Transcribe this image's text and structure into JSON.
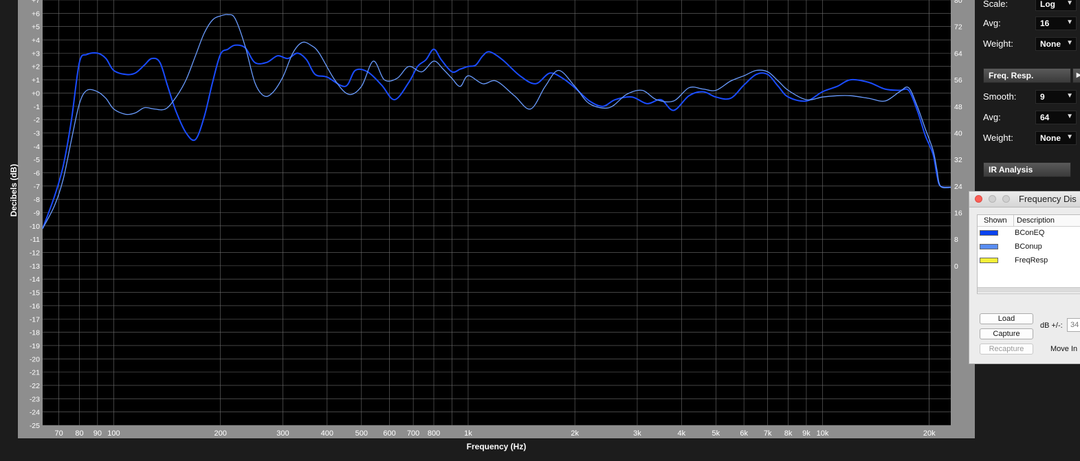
{
  "graph": {
    "y_axis_title": "Decibels (dB)",
    "x_axis_title": "Frequency (Hz)"
  },
  "chart_data": {
    "type": "line",
    "xscale": "log",
    "xlim": [
      63,
      23000
    ],
    "ylim": [
      -25,
      7
    ],
    "right_ylim": [
      -48,
      80
    ],
    "left_ticks": [
      "+7",
      "+6",
      "+5",
      "+4",
      "+3",
      "+2",
      "+1",
      "+0",
      "-1",
      "-2",
      "-3",
      "-4",
      "-5",
      "-6",
      "-7",
      "-8",
      "-9",
      "-10",
      "-11",
      "-12",
      "-13",
      "-14",
      "-15",
      "-16",
      "-17",
      "-18",
      "-19",
      "-20",
      "-21",
      "-22",
      "-23",
      "-24",
      "-25"
    ],
    "right_ticks": [
      "80",
      "72",
      "64",
      "56",
      "48",
      "40",
      "32",
      "24",
      "16",
      "8",
      "0"
    ],
    "x_ticks": [
      {
        "f": 70,
        "label": "70"
      },
      {
        "f": 80,
        "label": "80"
      },
      {
        "f": 90,
        "label": "90"
      },
      {
        "f": 100,
        "label": "100"
      },
      {
        "f": 200,
        "label": "200"
      },
      {
        "f": 300,
        "label": "300"
      },
      {
        "f": 400,
        "label": "400"
      },
      {
        "f": 500,
        "label": "500"
      },
      {
        "f": 600,
        "label": "600"
      },
      {
        "f": 700,
        "label": "700"
      },
      {
        "f": 800,
        "label": "800"
      },
      {
        "f": 1000,
        "label": "1k"
      },
      {
        "f": 2000,
        "label": "2k"
      },
      {
        "f": 3000,
        "label": "3k"
      },
      {
        "f": 4000,
        "label": "4k"
      },
      {
        "f": 5000,
        "label": "5k"
      },
      {
        "f": 6000,
        "label": "6k"
      },
      {
        "f": 7000,
        "label": "7k"
      },
      {
        "f": 8000,
        "label": "8k"
      },
      {
        "f": 9000,
        "label": "9k"
      },
      {
        "f": 10000,
        "label": "10k"
      },
      {
        "f": 20000,
        "label": "20k"
      }
    ],
    "series": [
      {
        "name": "BConEQ",
        "color": "#1a4cff",
        "points": [
          [
            63,
            -10.2
          ],
          [
            68,
            -7.8
          ],
          [
            72,
            -5.5
          ],
          [
            76,
            -2.0
          ],
          [
            80,
            2.3
          ],
          [
            84,
            2.9
          ],
          [
            90,
            3.0
          ],
          [
            95,
            2.6
          ],
          [
            100,
            1.7
          ],
          [
            108,
            1.4
          ],
          [
            115,
            1.5
          ],
          [
            122,
            2.1
          ],
          [
            128,
            2.6
          ],
          [
            135,
            2.3
          ],
          [
            142,
            0.5
          ],
          [
            150,
            -1.4
          ],
          [
            160,
            -3.0
          ],
          [
            170,
            -3.5
          ],
          [
            180,
            -1.8
          ],
          [
            190,
            0.8
          ],
          [
            200,
            2.9
          ],
          [
            210,
            3.3
          ],
          [
            220,
            3.6
          ],
          [
            235,
            3.4
          ],
          [
            250,
            2.3
          ],
          [
            270,
            2.3
          ],
          [
            290,
            2.8
          ],
          [
            310,
            2.6
          ],
          [
            330,
            3.0
          ],
          [
            350,
            2.5
          ],
          [
            370,
            1.4
          ],
          [
            400,
            1.2
          ],
          [
            450,
            0.5
          ],
          [
            480,
            1.7
          ],
          [
            520,
            1.6
          ],
          [
            570,
            0.6
          ],
          [
            620,
            -0.5
          ],
          [
            680,
            0.8
          ],
          [
            720,
            2.0
          ],
          [
            760,
            2.5
          ],
          [
            800,
            3.3
          ],
          [
            840,
            2.5
          ],
          [
            900,
            1.6
          ],
          [
            950,
            1.8
          ],
          [
            1000,
            2.0
          ],
          [
            1050,
            2.1
          ],
          [
            1100,
            2.8
          ],
          [
            1150,
            3.1
          ],
          [
            1250,
            2.5
          ],
          [
            1400,
            1.3
          ],
          [
            1550,
            0.7
          ],
          [
            1700,
            1.5
          ],
          [
            1850,
            1.1
          ],
          [
            2000,
            0.4
          ],
          [
            2200,
            -0.6
          ],
          [
            2400,
            -1.0
          ],
          [
            2600,
            -0.5
          ],
          [
            2900,
            -0.3
          ],
          [
            3200,
            -0.8
          ],
          [
            3500,
            -0.5
          ],
          [
            3800,
            -1.3
          ],
          [
            4200,
            -0.2
          ],
          [
            4600,
            0.1
          ],
          [
            5000,
            -0.3
          ],
          [
            5500,
            -0.4
          ],
          [
            6000,
            0.6
          ],
          [
            6500,
            1.4
          ],
          [
            7000,
            1.4
          ],
          [
            7500,
            0.5
          ],
          [
            8000,
            -0.3
          ],
          [
            9000,
            -0.6
          ],
          [
            10000,
            0.1
          ],
          [
            11000,
            0.5
          ],
          [
            12000,
            1.0
          ],
          [
            13500,
            0.8
          ],
          [
            15000,
            0.3
          ],
          [
            16500,
            0.2
          ],
          [
            17500,
            0.2
          ],
          [
            18500,
            -1.3
          ],
          [
            19500,
            -3.2
          ],
          [
            20500,
            -4.6
          ],
          [
            21000,
            -6.1
          ],
          [
            21500,
            -7.0
          ],
          [
            23000,
            -7.1
          ]
        ]
      },
      {
        "name": "BConup",
        "color": "#6a9cff",
        "points": [
          [
            63,
            -10.2
          ],
          [
            68,
            -8.5
          ],
          [
            72,
            -6.5
          ],
          [
            76,
            -3.5
          ],
          [
            80,
            -0.8
          ],
          [
            84,
            0.2
          ],
          [
            90,
            0.1
          ],
          [
            95,
            -0.4
          ],
          [
            100,
            -1.2
          ],
          [
            108,
            -1.6
          ],
          [
            115,
            -1.5
          ],
          [
            122,
            -1.1
          ],
          [
            130,
            -1.2
          ],
          [
            140,
            -1.2
          ],
          [
            150,
            -0.3
          ],
          [
            160,
            1.0
          ],
          [
            170,
            2.8
          ],
          [
            180,
            4.5
          ],
          [
            190,
            5.5
          ],
          [
            200,
            5.8
          ],
          [
            210,
            5.9
          ],
          [
            220,
            5.6
          ],
          [
            235,
            3.5
          ],
          [
            250,
            0.8
          ],
          [
            265,
            -0.2
          ],
          [
            280,
            0.0
          ],
          [
            300,
            1.2
          ],
          [
            320,
            3.0
          ],
          [
            340,
            3.8
          ],
          [
            360,
            3.6
          ],
          [
            380,
            3.0
          ],
          [
            420,
            1.0
          ],
          [
            460,
            -0.1
          ],
          [
            500,
            0.5
          ],
          [
            540,
            2.4
          ],
          [
            580,
            1.0
          ],
          [
            630,
            1.1
          ],
          [
            680,
            2.0
          ],
          [
            740,
            1.6
          ],
          [
            800,
            2.4
          ],
          [
            850,
            1.8
          ],
          [
            900,
            1.1
          ],
          [
            950,
            0.5
          ],
          [
            1000,
            1.3
          ],
          [
            1100,
            0.7
          ],
          [
            1200,
            0.9
          ],
          [
            1350,
            -0.2
          ],
          [
            1500,
            -1.2
          ],
          [
            1650,
            0.5
          ],
          [
            1800,
            1.7
          ],
          [
            2000,
            0.5
          ],
          [
            2200,
            -0.8
          ],
          [
            2500,
            -1.1
          ],
          [
            2800,
            -0.1
          ],
          [
            3100,
            0.2
          ],
          [
            3400,
            -0.5
          ],
          [
            3800,
            -0.6
          ],
          [
            4200,
            0.4
          ],
          [
            4600,
            0.3
          ],
          [
            5000,
            0.2
          ],
          [
            5500,
            0.9
          ],
          [
            6000,
            1.3
          ],
          [
            6500,
            1.7
          ],
          [
            7000,
            1.6
          ],
          [
            7500,
            0.9
          ],
          [
            8000,
            0.2
          ],
          [
            9000,
            -0.5
          ],
          [
            10000,
            -0.3
          ],
          [
            11000,
            -0.2
          ],
          [
            12000,
            -0.2
          ],
          [
            13500,
            -0.4
          ],
          [
            15000,
            -0.6
          ],
          [
            16500,
            0.1
          ],
          [
            17500,
            0.4
          ],
          [
            18500,
            -1.0
          ],
          [
            19500,
            -2.7
          ],
          [
            20500,
            -4.3
          ],
          [
            21000,
            -5.7
          ],
          [
            21500,
            -7.0
          ],
          [
            23000,
            -7.1
          ]
        ]
      }
    ]
  },
  "sidebar": {
    "scale_label": "Scale:",
    "scale_value": "Log",
    "avg1_label": "Avg:",
    "avg1_value": "16",
    "weight1_label": "Weight:",
    "weight1_value": "None",
    "freq_resp_button": "Freq. Resp.",
    "smooth_label": "Smooth:",
    "smooth_value": "9",
    "avg2_label": "Avg:",
    "avg2_value": "64",
    "weight2_label": "Weight:",
    "weight2_value": "None",
    "ir_analysis_button": "IR Analysis"
  },
  "dialog": {
    "title": "Frequency Dis",
    "col_shown": "Shown",
    "col_description": "Description",
    "rows": [
      {
        "description": "BConEQ",
        "color": "#0b43f0"
      },
      {
        "description": "BConup",
        "color": "#5a8df2"
      },
      {
        "description": "FreqResp",
        "color": "#f4f038"
      }
    ],
    "load_button": "Load",
    "capture_button": "Capture",
    "recapture_button": "Recapture",
    "db_label": "dB +/-:",
    "db_value": "34",
    "move_label": "Move In"
  }
}
